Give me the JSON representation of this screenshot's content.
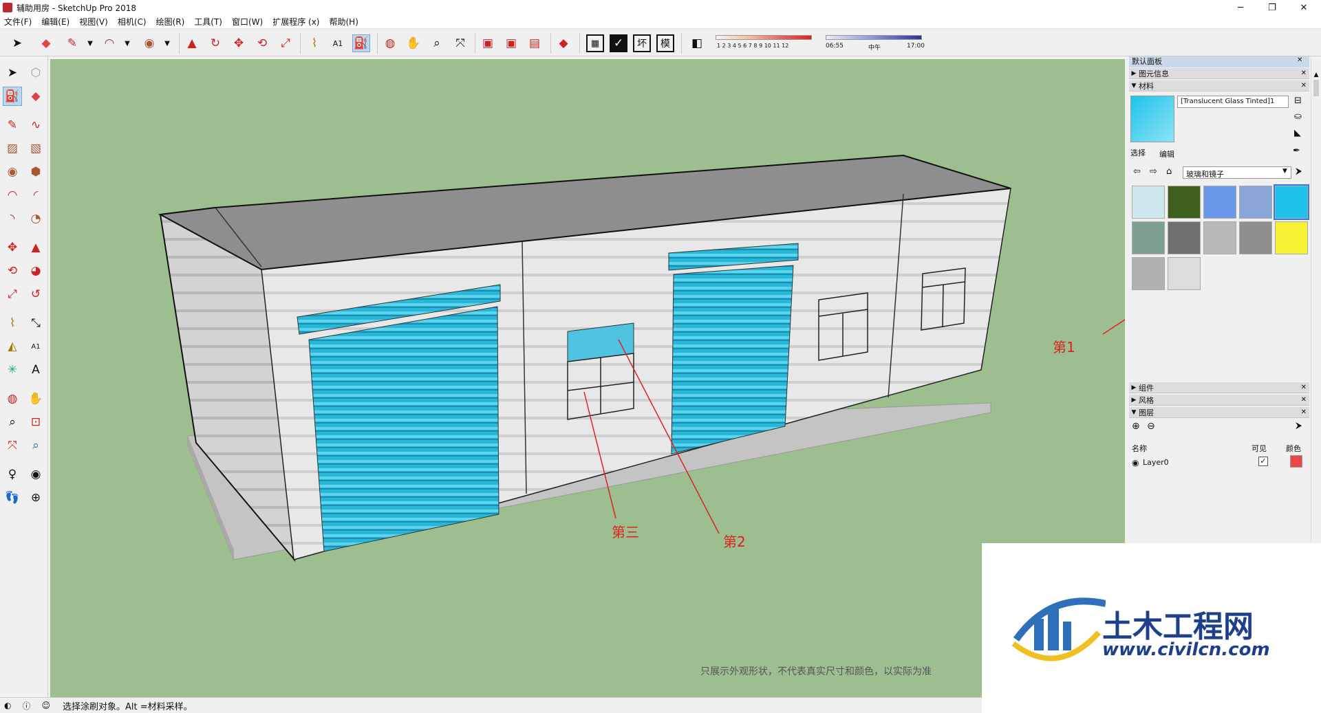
{
  "window": {
    "title": "辅助用房 - SketchUp Pro 2018",
    "min": "─",
    "max": "❐",
    "close": "✕"
  },
  "menu": [
    "文件(F)",
    "编辑(E)",
    "视图(V)",
    "相机(C)",
    "绘图(R)",
    "工具(T)",
    "窗口(W)",
    "扩展程序 (x)",
    "帮助(H)"
  ],
  "toolbar": {
    "extras": [
      "坏",
      "模"
    ],
    "shadow_months": "1 2 3 4 5 6 7 8 9 10 11 12",
    "time_start": "06:55",
    "time_mid": "中午",
    "time_end": "17:00"
  },
  "tray": {
    "title": "默认面板",
    "sections": {
      "entity_info": "图元信息",
      "materials": "材料",
      "components": "组件",
      "styles": "风格",
      "layers": "图层"
    },
    "material_name": "[Translucent Glass Tinted]1",
    "tabs": {
      "select": "选择",
      "edit": "编辑"
    },
    "collection": "玻璃和镜子",
    "layers": {
      "headers": {
        "name": "名称",
        "visible": "可见",
        "color": "颜色"
      },
      "rows": [
        {
          "name": "Layer0",
          "visible": "✓",
          "color": "#e84848"
        }
      ]
    },
    "swatch_colors": [
      "#cfe8ef",
      "#3f5f1f",
      "#6b98e8",
      "#8aa6d8",
      "#1fc3ea",
      "#7f9f8f",
      "#6f6f6f",
      "#b8b8b8",
      "#8f8f8f",
      "#f5f233",
      "#b0b0b0",
      "#dcdcdc"
    ]
  },
  "annotations": {
    "first": "第1",
    "second": "第2",
    "third": "第三",
    "disclaimer": "只展示外观形状，不代表真实尺寸和颜色，以实际为准"
  },
  "watermark": {
    "brand": "土木工程网",
    "url": "www.civilcn.com"
  },
  "statusbar": {
    "text": "选择涂刷对象。Alt =材料采样。"
  }
}
